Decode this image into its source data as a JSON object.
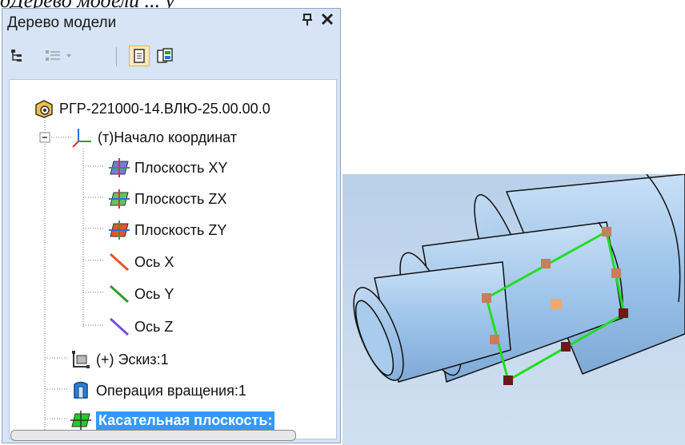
{
  "header_text": "дДерево модели ... у",
  "panel": {
    "title": "Дерево модели",
    "pin_glyph": "ф",
    "close_glyph": "✕"
  },
  "toolbar": {
    "buttons": [
      {
        "icon": "tree-structure-icon"
      },
      {
        "icon": "filter-dropdown-icon"
      },
      {
        "icon": "document-icon"
      },
      {
        "icon": "document-refresh-icon"
      }
    ]
  },
  "tree": {
    "root": "РГР-221000-14.ВЛЮ-25.00.00.0",
    "origin": "(т)Начало координат",
    "plane_xy": "Плоскость XY",
    "plane_zx": "Плоскость ZX",
    "plane_zy": "Плоскость ZY",
    "axis_x": "Ось X",
    "axis_y": "Ось Y",
    "axis_z": "Ось Z",
    "sketch": "(+) Эскиз:1",
    "revolve": "Операция вращения:1",
    "tangent_plane": "Касательная плоскость:"
  },
  "colors": {
    "selection": "#3399ff",
    "panel_bg": "#d6e4f5",
    "sketch_line": "#22dd22",
    "model_fill": "#9cc3ea"
  }
}
